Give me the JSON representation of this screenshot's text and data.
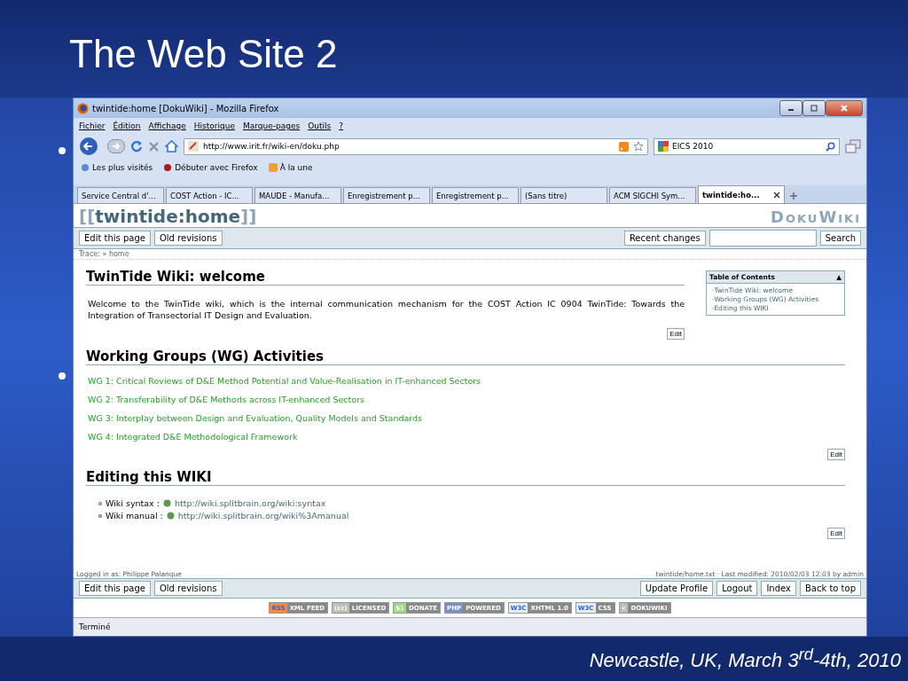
{
  "slide": {
    "title": "The Web Site 2",
    "footer": "Newcastle, UK, March 3$^{rd}$-4th, 2010"
  },
  "window": {
    "title": "twintide:home [DokuWiki] - Mozilla Firefox"
  },
  "menu": [
    "Fichier",
    "Édition",
    "Affichage",
    "Historique",
    "Marque-pages",
    "Outils",
    "?"
  ],
  "address": {
    "value": "http://www.irit.fr/wiki-en/doku.php"
  },
  "search": {
    "value": "EICS 2010"
  },
  "bookmarks": [
    "Les plus visités",
    "Débuter avec Firefox",
    "À la une"
  ],
  "tabs": [
    {
      "label": "Service Central d'...",
      "selected": false
    },
    {
      "label": "COST Action - IC...",
      "selected": false
    },
    {
      "label": "MAUDE - Manufa...",
      "selected": false
    },
    {
      "label": "Enregistrement p...",
      "selected": false
    },
    {
      "label": "Enregistrement p...",
      "selected": false
    },
    {
      "label": "(Sans titre)",
      "selected": false
    },
    {
      "label": "ACM SIGCHI Sym...",
      "selected": false
    },
    {
      "label": "twintide:ho...",
      "selected": true
    }
  ],
  "wiki": {
    "open": "[[",
    "title": "twintide:home",
    "close": "]]",
    "logo": "DokuWiki",
    "top_buttons": [
      "Edit this page",
      "Old revisions"
    ],
    "right_buttons": [
      "Recent changes"
    ],
    "search_button": "Search",
    "trace": "Trace: » home",
    "toc": {
      "title": "Table of Contents",
      "toggle": "▲",
      "items": [
        "·TwinTide Wiki: welcome",
        "·Working Groups (WG) Activities",
        "·Editing this WIKI"
      ]
    },
    "sections": [
      {
        "heading": "TwinTide Wiki: welcome",
        "kind": "text",
        "text": "Welcome to the TwinTide wiki, which is the internal communication mechanism for the COST Action IC 0904 TwinTide: Towards the Integration of Transectorial IT Design and Evaluation.",
        "edit": "Edit"
      },
      {
        "heading": "Working Groups (WG) Activities",
        "kind": "links",
        "links": [
          "WG 1: Critical Reviews of D&E Method Potential and Value-Realisation in IT-enhanced Sectors",
          "WG 2: Transferability of D&E Methods across IT-enhanced Sectors",
          "WG 3: Interplay between Design and Evaluation, Quality Models and Standards",
          "WG 4: Integrated D&E Methodological Framework"
        ],
        "edit": "Edit"
      },
      {
        "heading": "Editing this WIKI",
        "kind": "list",
        "items": [
          {
            "label": "Wiki syntax :",
            "url": "http://wiki.splitbrain.org/wiki:syntax"
          },
          {
            "label": "Wiki manual :",
            "url": "http://wiki.splitbrain.org/wiki%3Amanual"
          }
        ],
        "edit": "Edit"
      }
    ],
    "logged_in": "Logged in as: Philippe Palanque",
    "modified": "twintide/home.txt · Last modified: 2010/02/03 12:03 by admin",
    "bottom_left": [
      "Edit this page",
      "Old revisions"
    ],
    "bottom_right": [
      "Update Profile",
      "Logout",
      "Index",
      "Back to top"
    ],
    "badges": [
      {
        "a": "RSS",
        "b": "XML FEED",
        "color": "#f08a4b"
      },
      {
        "a": "(cc)",
        "b": "LICENSED",
        "color": "#bdbdb5"
      },
      {
        "a": "$1",
        "b": "DONATE",
        "color": "#9fd98a"
      },
      {
        "a": "PHP",
        "b": "POWERED",
        "color": "#7a8fc2"
      },
      {
        "a": "W3C",
        "b": "XHTML 1.0",
        "color": "#e4ecf8"
      },
      {
        "a": "W3C",
        "b": "CSS",
        "color": "#e4ecf8"
      },
      {
        "a": "<",
        "b": "DOKUWIKI",
        "color": "#bdbdb5"
      }
    ]
  },
  "status": "Terminé"
}
